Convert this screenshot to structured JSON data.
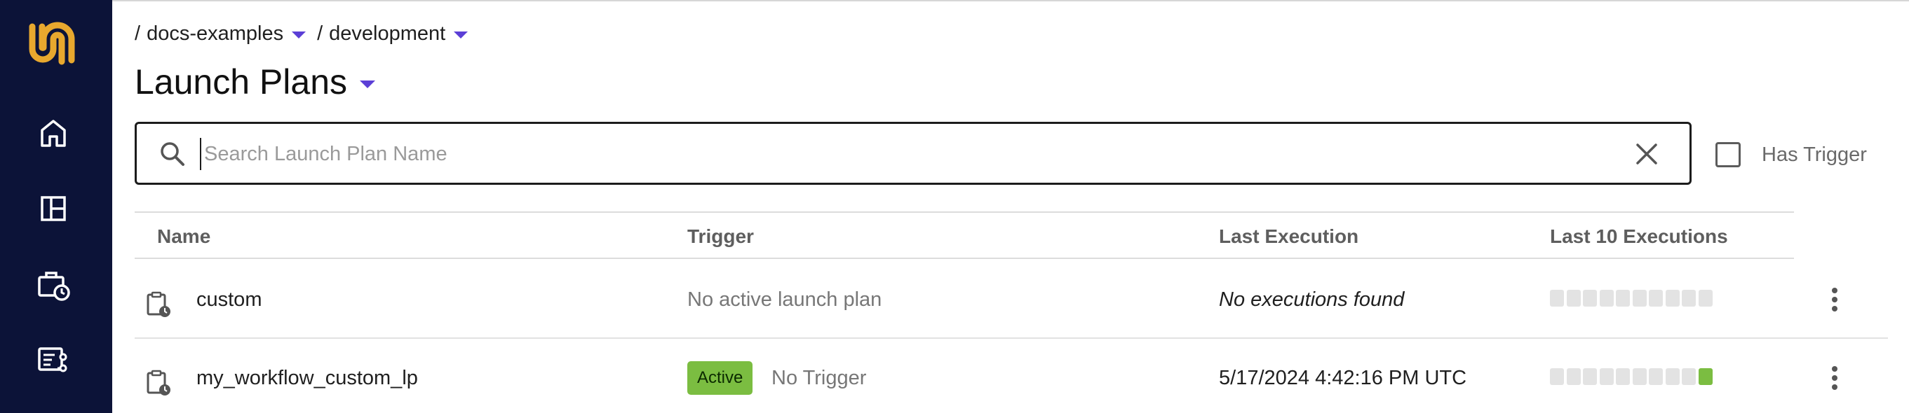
{
  "breadcrumb": {
    "project": "docs-examples",
    "domain": "development",
    "separator": "/"
  },
  "page": {
    "title": "Launch Plans"
  },
  "search": {
    "placeholder": "Search Launch Plan Name",
    "value": ""
  },
  "filter": {
    "has_trigger_label": "Has Trigger",
    "has_trigger_checked": false
  },
  "table": {
    "columns": [
      "Name",
      "Trigger",
      "Last Execution",
      "Last 10 Executions"
    ],
    "rows": [
      {
        "name": "custom",
        "status_badge": "",
        "trigger": "No active launch plan",
        "last_execution": "No executions found",
        "last_10_executions": [
          "none",
          "none",
          "none",
          "none",
          "none",
          "none",
          "none",
          "none",
          "none",
          "none"
        ]
      },
      {
        "name": "my_workflow_custom_lp",
        "status_badge": "Active",
        "trigger": "No Trigger",
        "last_execution": "5/17/2024 4:42:16 PM UTC",
        "last_10_executions": [
          "none",
          "none",
          "none",
          "none",
          "none",
          "none",
          "none",
          "none",
          "none",
          "success"
        ]
      }
    ]
  },
  "sidebar": {
    "items": [
      {
        "icon": "home-icon"
      },
      {
        "icon": "dashboard-icon"
      },
      {
        "icon": "scheduled-briefcase-icon"
      },
      {
        "icon": "task-list-icon"
      }
    ]
  },
  "colors": {
    "sidebar_bg": "#0c1338",
    "logo": "#e8a82e",
    "accent": "#5b3fd6",
    "active_badge": "#7bbd41",
    "success_bar": "#7bbd41",
    "empty_bar": "#e3e3e3"
  }
}
